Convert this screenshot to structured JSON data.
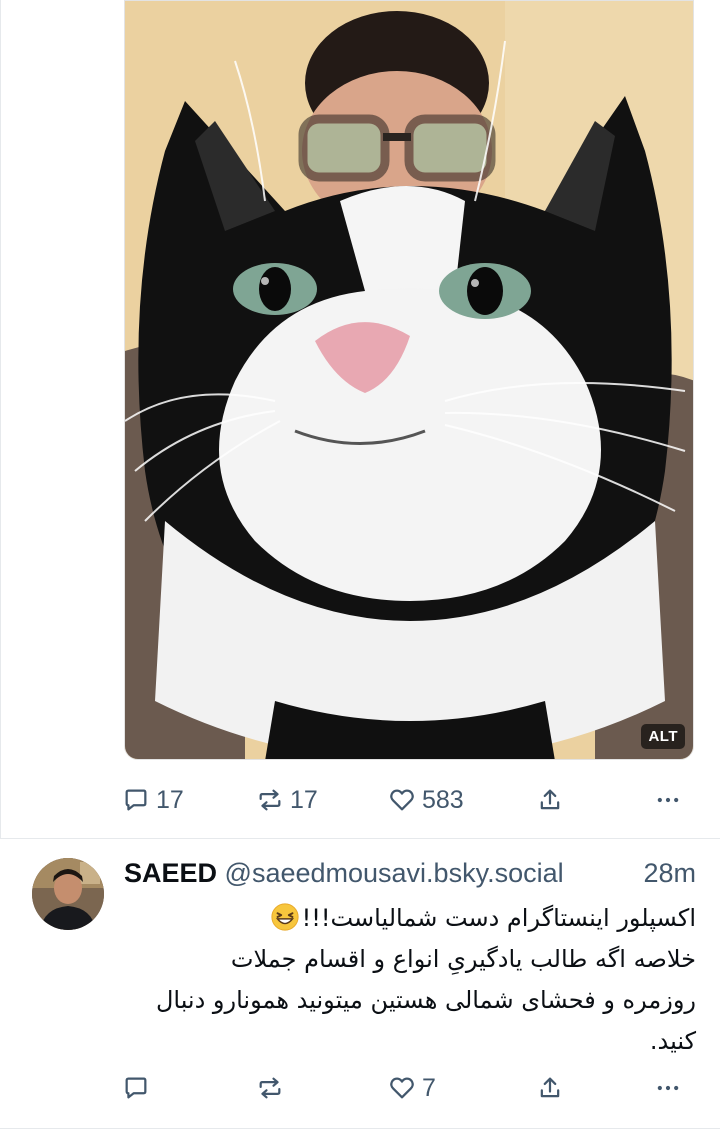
{
  "post1": {
    "media_alt_badge": "ALT",
    "reply_count": "17",
    "repost_count": "17",
    "like_count": "583"
  },
  "post2": {
    "display_name": "SAEED",
    "handle": "@saeedmousavi.bsky.social",
    "time": "28m",
    "text_lines": [
      "اکسپلور اینستاگرام دست شمالیاست!!!",
      "خلاصه اگه طالب یادگیریِ انواع و اقسام جملات",
      "روزمره و فحشای شمالی هستین میتونید همونارو دنبال",
      "کنید."
    ],
    "like_count": "7"
  },
  "icons": {
    "reply": "reply-icon",
    "repost": "repost-icon",
    "like": "heart-icon",
    "share": "share-icon",
    "more": "more-icon",
    "emoji": "grinning-squinting-face-emoji"
  },
  "colors": {
    "muted": "#42576c",
    "divider": "#e6e9ec",
    "text": "#0b0f14"
  }
}
